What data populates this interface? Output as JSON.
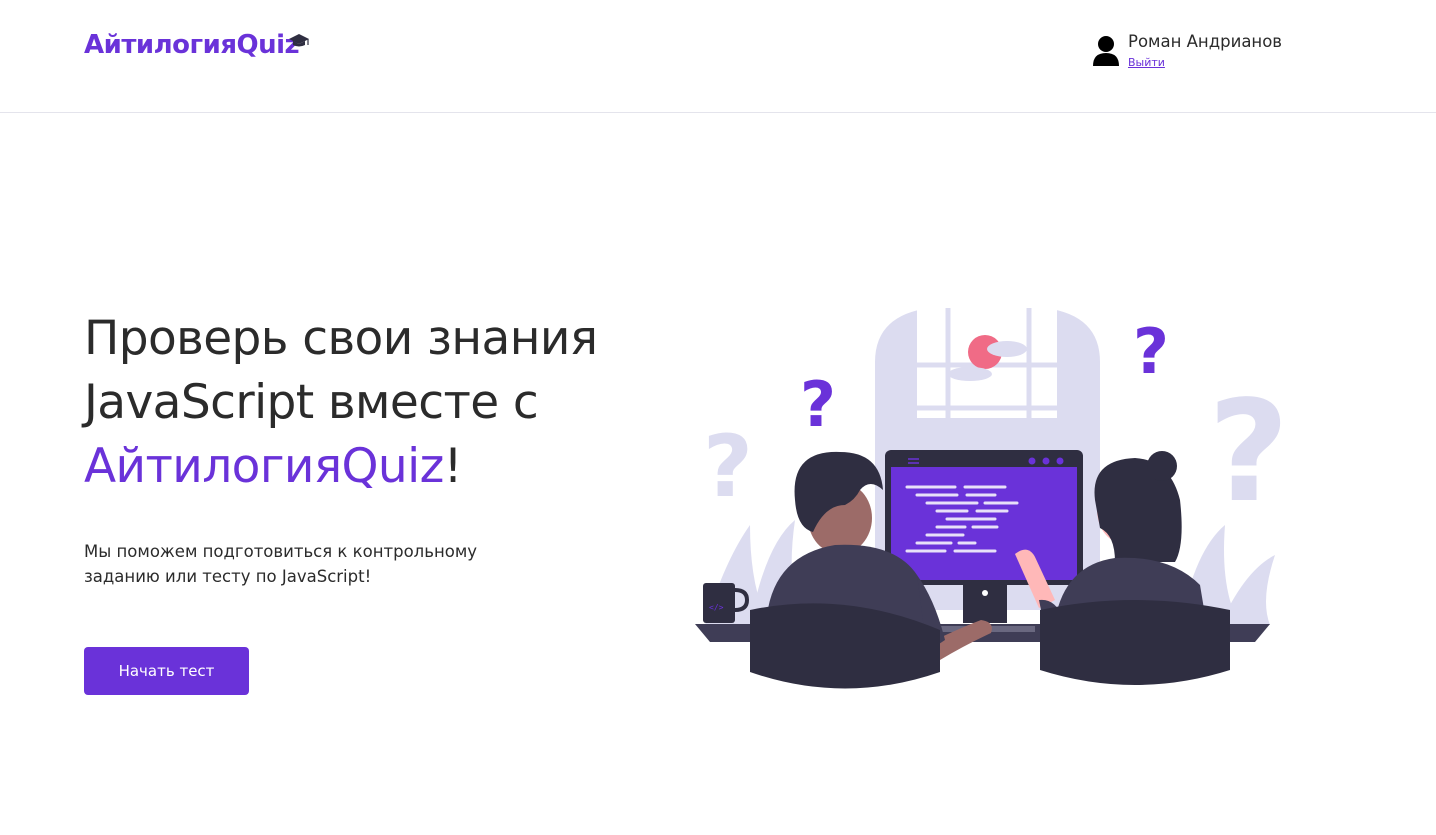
{
  "header": {
    "logo_text": "АйтилогияQuiz",
    "user_name": "Роман Андрианов",
    "logout_label": "Выйти"
  },
  "hero": {
    "title_line1": "Проверь свои знания",
    "title_line2": "JavaScript вместе с",
    "title_brand": "АйтилогияQuiz",
    "title_end": "!",
    "description": "Мы поможем подготовиться к контрольному заданию или тесту по JavaScript!",
    "button_label": "Начать тест"
  },
  "icons": {
    "logo": "graduation-cap-icon",
    "user": "user-icon"
  },
  "colors": {
    "accent": "#6a32d9",
    "text": "#2b2b2b",
    "illustration_light": "#dcdcf0",
    "illustration_dark": "#2f2e41"
  }
}
